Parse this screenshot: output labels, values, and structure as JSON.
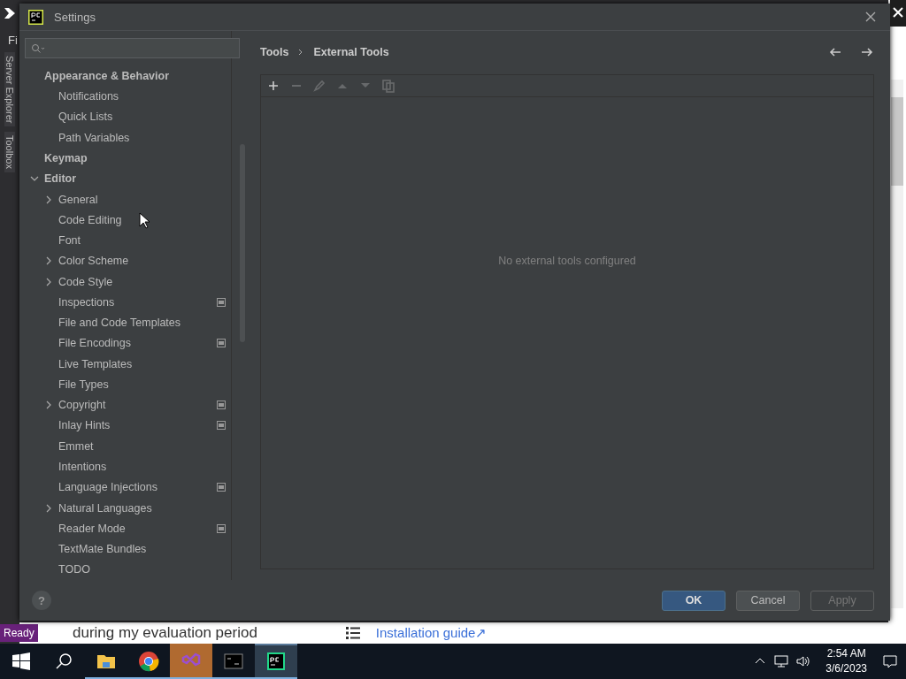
{
  "background_ide": {
    "menu_text": "Fi",
    "side_tabs": [
      "Server Explorer",
      "Toolbox"
    ],
    "status": "Ready"
  },
  "background_page": {
    "text": "during my evaluation period",
    "link": "Installation guide↗"
  },
  "window": {
    "title": "Settings"
  },
  "help": "?",
  "tree": [
    {
      "label": "Appearance & Behavior",
      "children": [
        {
          "label": "Notifications"
        },
        {
          "label": "Quick Lists"
        },
        {
          "label": "Path Variables"
        }
      ]
    },
    {
      "label": "Keymap"
    },
    {
      "label": "Editor",
      "expanded": true,
      "children": [
        {
          "label": "General",
          "expanded": false
        },
        {
          "label": "Code Editing"
        },
        {
          "label": "Font"
        },
        {
          "label": "Color Scheme",
          "expanded": false
        },
        {
          "label": "Code Style",
          "expanded": false
        },
        {
          "label": "Inspections",
          "project": true
        },
        {
          "label": "File and Code Templates"
        },
        {
          "label": "File Encodings",
          "project": true
        },
        {
          "label": "Live Templates"
        },
        {
          "label": "File Types"
        },
        {
          "label": "Copyright",
          "expanded": false,
          "project": true
        },
        {
          "label": "Inlay Hints",
          "project": true
        },
        {
          "label": "Emmet"
        },
        {
          "label": "Intentions"
        },
        {
          "label": "Language Injections",
          "project": true
        },
        {
          "label": "Natural Languages",
          "expanded": false
        },
        {
          "label": "Reader Mode",
          "project": true
        },
        {
          "label": "TextMate Bundles"
        },
        {
          "label": "TODO"
        }
      ]
    }
  ],
  "breadcrumb": [
    "Tools",
    "External Tools"
  ],
  "toolbar": [
    {
      "kind": "add",
      "disabled": false
    },
    {
      "kind": "remove",
      "disabled": true
    },
    {
      "kind": "edit",
      "disabled": true
    },
    {
      "kind": "up",
      "disabled": true
    },
    {
      "kind": "down",
      "disabled": true
    },
    {
      "kind": "copy",
      "disabled": true
    }
  ],
  "empty_text": "No external tools configured",
  "buttons": [
    {
      "label": "OK",
      "kind": "primary",
      "disabled": false
    },
    {
      "label": "Cancel",
      "kind": "normal",
      "disabled": false
    },
    {
      "label": "Apply",
      "kind": "normal",
      "disabled": true
    }
  ],
  "taskbar": {
    "apps": [
      {
        "kind": "explorer",
        "running": true,
        "flashing": false,
        "selected": false
      },
      {
        "kind": "chrome",
        "running": true,
        "flashing": false,
        "selected": false
      },
      {
        "kind": "vs",
        "running": true,
        "flashing": true,
        "selected": false
      },
      {
        "kind": "terminal",
        "running": true,
        "flashing": false,
        "selected": false
      },
      {
        "kind": "pycharm",
        "running": true,
        "flashing": false,
        "selected": true
      }
    ],
    "time": "2:54 AM",
    "date": "3/6/2023"
  }
}
